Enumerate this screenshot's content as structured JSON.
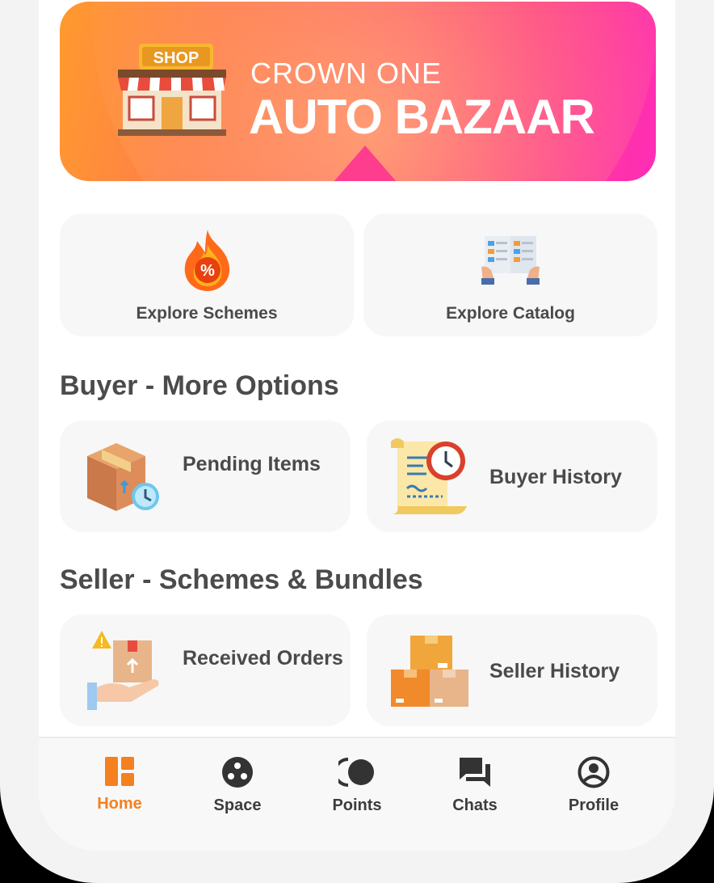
{
  "banner": {
    "subtitle": "CROWN ONE",
    "title": "AUTO BAZAAR",
    "logo_text": "SHOP"
  },
  "quick_actions": [
    {
      "label": "Explore Schemes",
      "icon": "fire-percent-icon"
    },
    {
      "label": "Explore Catalog",
      "icon": "catalog-book-icon"
    }
  ],
  "buyer_section": {
    "title": "Buyer - More Options",
    "items": [
      {
        "label": "Pending Items",
        "icon": "box-clock-icon"
      },
      {
        "label": "Buyer History",
        "icon": "receipt-clock-icon"
      }
    ]
  },
  "seller_section": {
    "title": "Seller - Schemes & Bundles",
    "items": [
      {
        "label": "Received Orders",
        "icon": "hand-package-icon"
      },
      {
        "label": "Seller History",
        "icon": "stacked-boxes-icon"
      }
    ]
  },
  "nav": {
    "items": [
      {
        "label": "Home",
        "icon": "dashboard-icon",
        "active": true
      },
      {
        "label": "Space",
        "icon": "space-dots-icon",
        "active": false
      },
      {
        "label": "Points",
        "icon": "points-coins-icon",
        "active": false
      },
      {
        "label": "Chats",
        "icon": "chat-bubbles-icon",
        "active": false
      },
      {
        "label": "Profile",
        "icon": "user-circle-icon",
        "active": false
      }
    ]
  },
  "colors": {
    "accent": "#f4801f",
    "banner_start": "#ff9a2e",
    "banner_end": "#ff2db6",
    "card_bg": "#f7f7f7",
    "text_dark": "#4a4a4a"
  }
}
